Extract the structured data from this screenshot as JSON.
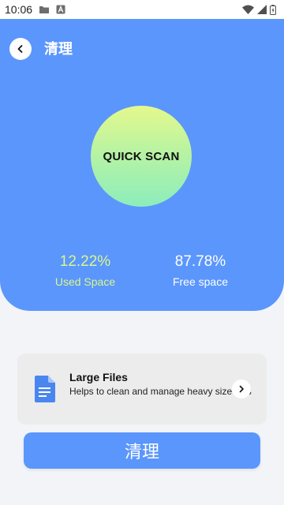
{
  "status_bar": {
    "time": "10:06",
    "icons": [
      "folder-icon",
      "a-letter-icon",
      "wifi-icon",
      "signal-icon",
      "battery-icon"
    ]
  },
  "header": {
    "back_icon": "chevron-left-icon",
    "title": "清理"
  },
  "scan": {
    "label": "QUICK SCAN"
  },
  "stats": {
    "used": {
      "value": "12.22%",
      "label": "Used Space"
    },
    "free": {
      "value": "87.78%",
      "label": "Free space"
    }
  },
  "large_files_card": {
    "icon": "document-icon",
    "title": "Large Files",
    "description": "Helps to clean and manage heavy size files",
    "chevron_icon": "chevron-right-icon"
  },
  "clean_button": {
    "label": "清理"
  },
  "colors": {
    "primary_blue": "#5b96fc",
    "used_green": "#d9f78a",
    "background": "#f2f4f8",
    "card_bg": "#ececec"
  }
}
